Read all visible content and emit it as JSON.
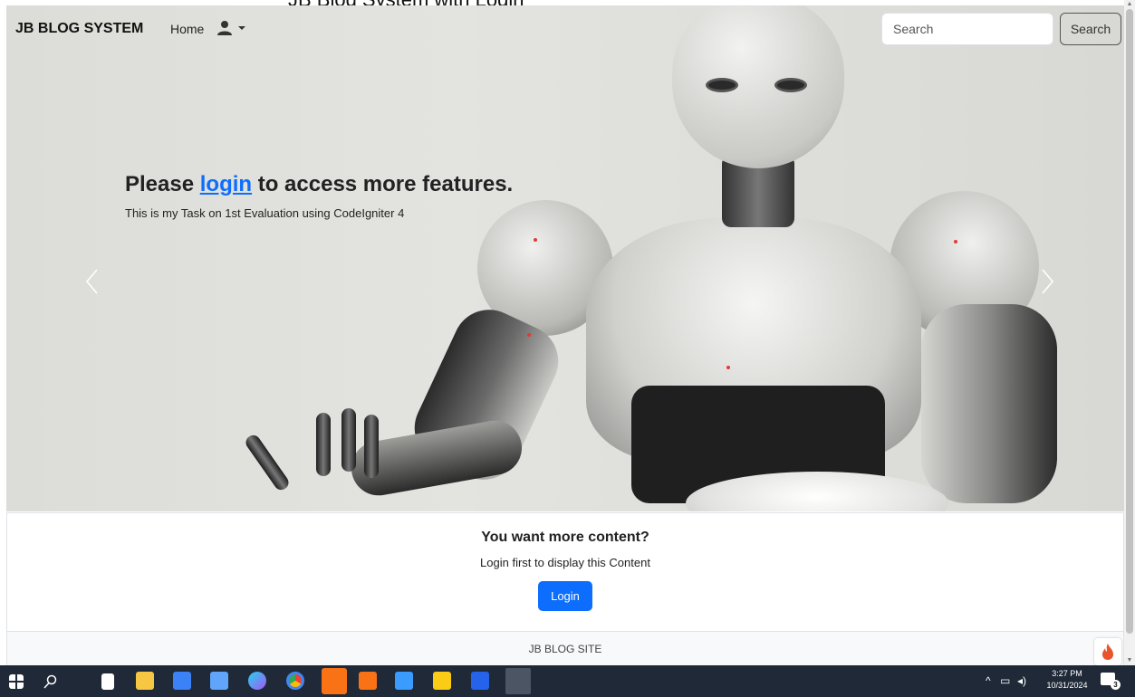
{
  "browser": {
    "page_title_cropped": "JB Blog System with Login"
  },
  "navbar": {
    "brand": "JB BLOG SYSTEM",
    "home_label": "Home",
    "search_placeholder": "Search",
    "search_button_label": "Search"
  },
  "hero": {
    "heading_prefix": "Please ",
    "heading_link": "login",
    "heading_suffix": " to access more features.",
    "subtext": "This is my Task on 1st Evaluation using CodeIgniter 4"
  },
  "content_card": {
    "title": "You want more content?",
    "text": "Login first to display this Content",
    "login_button_label": "Login"
  },
  "footer": {
    "text": "JB BLOG SITE"
  },
  "taskbar": {
    "time": "3:27 PM",
    "date": "10/31/2024",
    "notification_count": "3",
    "apps": [
      "windows-start",
      "search",
      "file",
      "file-explorer",
      "store",
      "mail",
      "copilot",
      "chrome",
      "app-badge",
      "xampp",
      "vscode",
      "sticky-notes",
      "word",
      "chrome-profile"
    ]
  },
  "colors": {
    "primary": "#0d6efd",
    "taskbar": "#1f2937",
    "brand_text": "#111111"
  }
}
